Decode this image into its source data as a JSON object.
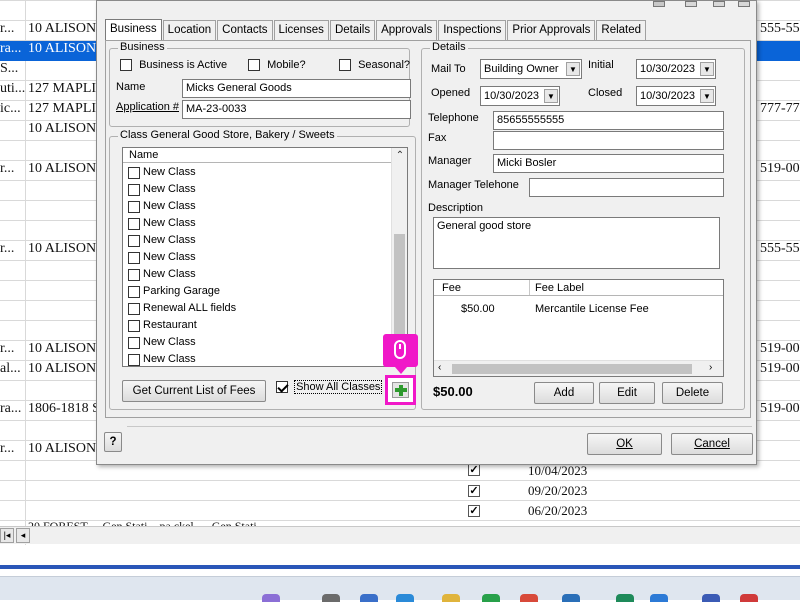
{
  "background": {
    "rows": [
      {
        "left": "r...",
        "addr": "10 ALISON",
        "right": "555-55"
      },
      {
        "left": "ra...",
        "addr": "10 ALISON",
        "right": ""
      },
      {
        "left": "S...",
        "addr": "",
        "right": ""
      },
      {
        "left": "uti...",
        "addr": "127 MAPLI",
        "right": ""
      },
      {
        "left": "ic...",
        "addr": "127 MAPLI",
        "right": "777-77"
      },
      {
        "left": "",
        "addr": "10 ALISON",
        "right": ""
      },
      {
        "left": "r...",
        "addr": "10 ALISON",
        "right": "519-00"
      },
      {
        "left": "r...",
        "addr": "10 ALISON",
        "right": "555-55"
      },
      {
        "left": "r...",
        "addr": "10 ALISON",
        "right": "519-00"
      },
      {
        "left": "al...",
        "addr": "10 ALISON",
        "right": "519-00"
      },
      {
        "left": "ra...",
        "addr": "1806-1818 S",
        "right": "519-00"
      },
      {
        "left": "r...",
        "addr": "10 ALISON",
        "right": ""
      }
    ],
    "dates": [
      "10/04/2023",
      "09/20/2023",
      "06/20/2023"
    ],
    "cut_text": "20 FOREST ... Gen Stati... pa.ckel. ... Gen Stati..."
  },
  "dialog": {
    "tabs": [
      "Business",
      "Location",
      "Contacts",
      "Licenses",
      "Details",
      "Approvals",
      "Inspections",
      "Prior Approvals",
      "Related"
    ],
    "active_tab": "Business",
    "business": {
      "group_label": "Business",
      "is_active_label": "Business is Active",
      "is_active": false,
      "mobile_label": "Mobile?",
      "mobile": false,
      "seasonal_label": "Seasonal?",
      "seasonal": false,
      "name_label": "Name",
      "name_value": "Micks General Goods",
      "application_label": "Application #",
      "application_value": "MA-23-0033"
    },
    "classes": {
      "group_label": "Class General Good Store, Bakery / Sweets",
      "column_header": "Name",
      "items": [
        {
          "label": "New Class",
          "checked": false
        },
        {
          "label": "New Class",
          "checked": false
        },
        {
          "label": "New Class",
          "checked": false
        },
        {
          "label": "New Class",
          "checked": false
        },
        {
          "label": "New Class",
          "checked": false
        },
        {
          "label": "New Class",
          "checked": false
        },
        {
          "label": "New Class",
          "checked": false
        },
        {
          "label": "Parking Garage",
          "checked": false
        },
        {
          "label": "Renewal ALL fields",
          "checked": false
        },
        {
          "label": "Restaurant",
          "checked": false
        },
        {
          "label": "New Class",
          "checked": false
        },
        {
          "label": "New Class",
          "checked": false
        }
      ],
      "get_fees_button": "Get Current List of Fees",
      "show_all_label": "Show All Classes",
      "show_all": true
    },
    "details": {
      "group_label": "Details",
      "mail_to_label": "Mail To",
      "mail_to_value": "Building Owner",
      "initial_label": "Initial",
      "initial_value": "10/30/2023",
      "opened_label": "Opened",
      "opened_value": "10/30/2023",
      "closed_label": "Closed",
      "closed_value": "10/30/2023",
      "telephone_label": "Telephone",
      "telephone_value": "85655555555",
      "fax_label": "Fax",
      "fax_value": "",
      "manager_label": "Manager",
      "manager_value": "Micki Bosler",
      "manager_tel_label": "Manager Telehone",
      "manager_tel_value": "",
      "description_label": "Description",
      "description_value": "General good store"
    },
    "fees": {
      "col_fee": "Fee",
      "col_label": "Fee Label",
      "rows": [
        {
          "fee": "$50.00",
          "label": "Mercantile License Fee"
        }
      ],
      "total": "$50.00",
      "add_button": "Add",
      "edit_button": "Edit",
      "delete_button": "Delete"
    },
    "footer": {
      "help_glyph": "?",
      "ok_button": "OK",
      "cancel_button": "Cancel"
    }
  },
  "colors": {
    "selection": "#0a64d8",
    "highlight": "#f018c8",
    "plus": "#2e9a2e"
  }
}
